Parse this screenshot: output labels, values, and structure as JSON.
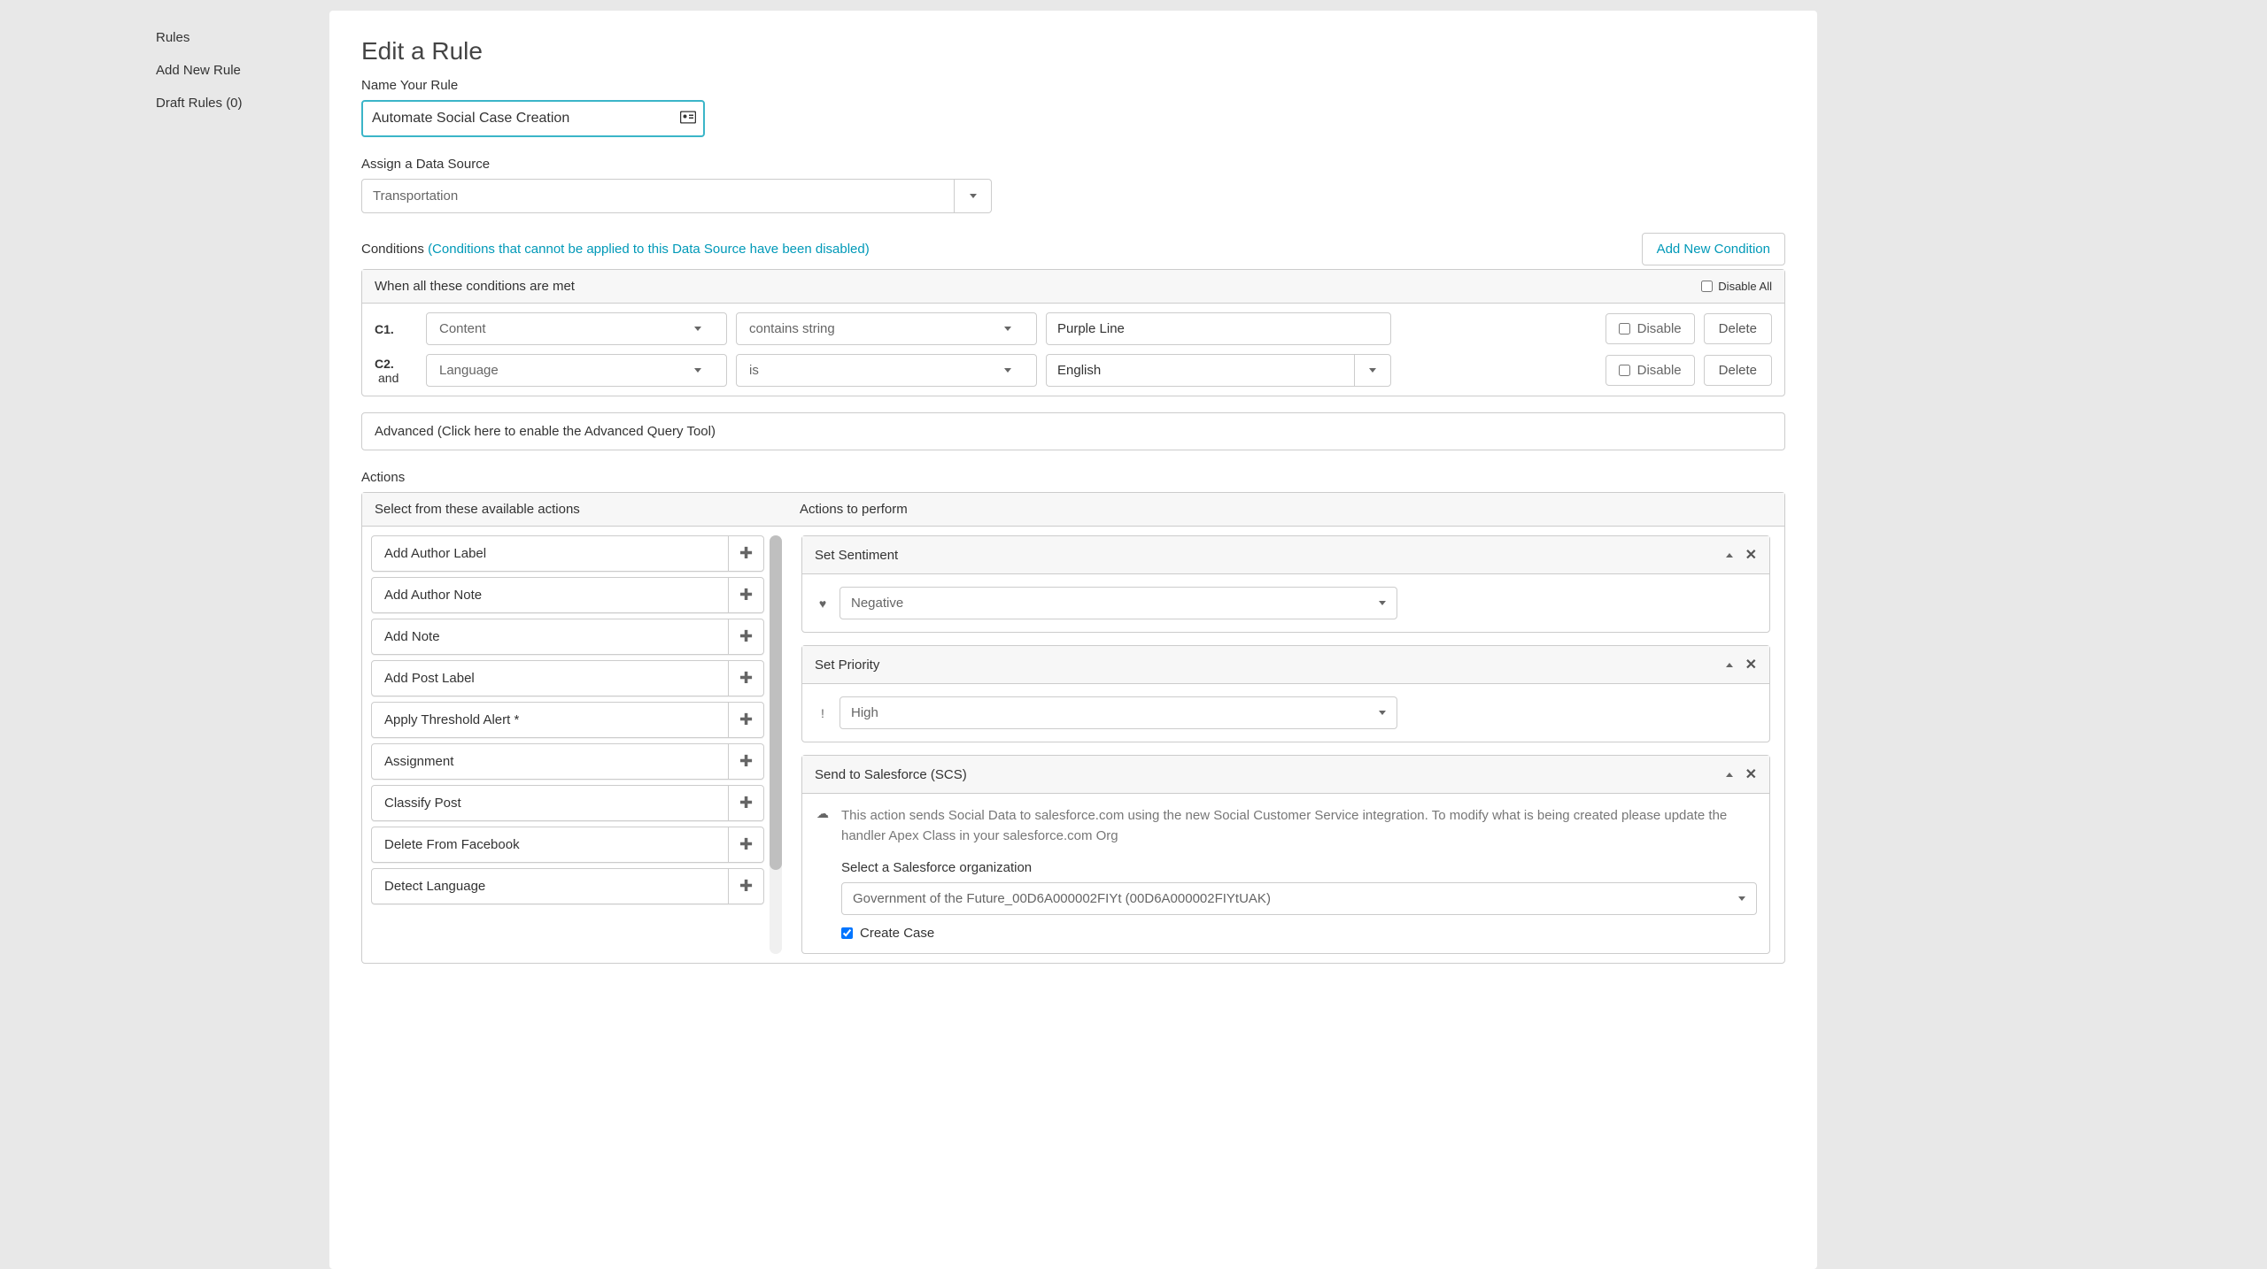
{
  "sidebar": {
    "items": [
      {
        "label": "Rules"
      },
      {
        "label": "Add New Rule"
      },
      {
        "label": "Draft Rules (0)"
      }
    ]
  },
  "page": {
    "title": "Edit a Rule",
    "name_label": "Name Your Rule",
    "rule_name": "Automate Social Case Creation",
    "data_source_label": "Assign a Data Source",
    "data_source_value": "Transportation"
  },
  "conditions": {
    "label": "Conditions",
    "note": "(Conditions that cannot be applied to this Data Source have been disabled)",
    "add_btn": "Add New Condition",
    "header": "When all these conditions are met",
    "disable_all": "Disable All",
    "rows": [
      {
        "idx": "C1.",
        "and": "",
        "field": "Content",
        "op": "contains string",
        "value": "Purple Line",
        "value_has_dropdown": false
      },
      {
        "idx": "C2.",
        "and": "and",
        "field": "Language",
        "op": "is",
        "value": "English",
        "value_has_dropdown": true
      }
    ],
    "disable_label": "Disable",
    "delete_label": "Delete"
  },
  "advanced": {
    "label": "Advanced (Click here to enable the Advanced Query Tool)"
  },
  "actions": {
    "label": "Actions",
    "available_header": "Select from these available actions",
    "perform_header": "Actions to perform",
    "available": [
      {
        "label": "Add Author Label"
      },
      {
        "label": "Add Author Note"
      },
      {
        "label": "Add Note"
      },
      {
        "label": "Add Post Label"
      },
      {
        "label": "Apply Threshold Alert *"
      },
      {
        "label": "Assignment"
      },
      {
        "label": "Classify Post"
      },
      {
        "label": "Delete From Facebook"
      },
      {
        "label": "Detect Language"
      }
    ],
    "perform": {
      "sentiment": {
        "title": "Set Sentiment",
        "icon": "♥",
        "value": "Negative"
      },
      "priority": {
        "title": "Set Priority",
        "icon": "!",
        "value": "High"
      },
      "salesforce": {
        "title": "Send to Salesforce (SCS)",
        "desc": "This action sends Social Data to salesforce.com using the new Social Customer Service integration. To modify what is being created please update the handler Apex Class in your salesforce.com Org",
        "org_label": "Select a Salesforce organization",
        "org_value": "Government of the Future_00D6A000002FIYt (00D6A000002FIYtUAK)",
        "create_case_label": "Create Case"
      }
    }
  }
}
